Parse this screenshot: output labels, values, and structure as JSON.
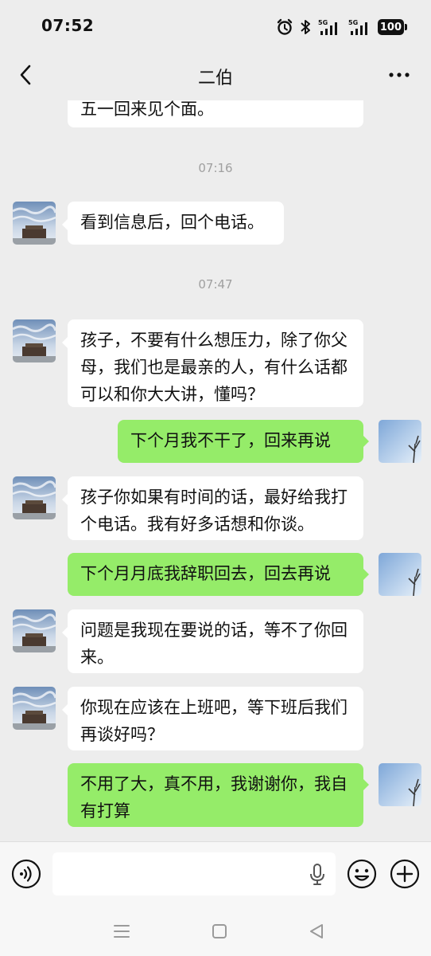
{
  "status_bar": {
    "time": "07:52",
    "battery": "100",
    "icons": [
      "alarm-icon",
      "bluetooth-icon",
      "signal-5g-icon",
      "signal-5g-icon",
      "battery-icon"
    ]
  },
  "header": {
    "title": "二伯",
    "back_icon": "chevron-left-icon",
    "more_icon": "more-horizontal-icon"
  },
  "messages": [
    {
      "type": "text",
      "from": "uncle",
      "text": "五一回来见个面。"
    },
    {
      "type": "time",
      "text": "07:16"
    },
    {
      "type": "text",
      "from": "uncle",
      "text": "看到信息后，回个电话。"
    },
    {
      "type": "time",
      "text": "07:47"
    },
    {
      "type": "text",
      "from": "uncle",
      "text": "孩子，不要有什么想压力，除了你父母，我们也是最亲的人，有什么话都可以和你大大讲，懂吗？"
    },
    {
      "type": "text",
      "from": "me",
      "text": "下个月我不干了，回来再说"
    },
    {
      "type": "text",
      "from": "uncle",
      "text": "孩子你如果有时间的话，最好给我打个电话。我有好多话想和你谈。"
    },
    {
      "type": "text",
      "from": "me",
      "text": "下个月月底我辞职回去，回去再说"
    },
    {
      "type": "text",
      "from": "uncle",
      "text": "问题是我现在要说的话，等不了你回来。"
    },
    {
      "type": "text",
      "from": "uncle",
      "text": "你现在应该在上班吧，等下班后我们再谈好吗？"
    },
    {
      "type": "text",
      "from": "me",
      "text": "不用了大，真不用，我谢谢你，我自有打算"
    }
  ],
  "input_bar": {
    "value": "",
    "voice_icon": "voice-icon",
    "mic_icon": "microphone-icon",
    "emoji_icon": "emoji-icon",
    "plus_icon": "plus-icon"
  },
  "system_nav": {
    "icons": [
      "menu-icon",
      "home-icon",
      "back-icon"
    ]
  },
  "colors": {
    "background": "#ededed",
    "incoming_bubble": "#ffffff",
    "outgoing_bubble": "#95ec69",
    "timestamp": "#a0a0a0"
  }
}
